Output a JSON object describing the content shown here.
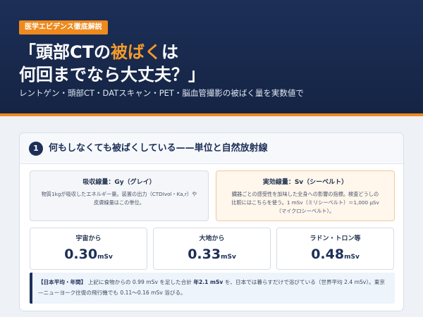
{
  "hero": {
    "badge": "医学エビデンス徹底解説",
    "title_line1_a": "「頭部CTの",
    "title_line1_accent": "被ばく",
    "title_line1_b": "は",
    "title_line2": "何回までなら大丈夫？」",
    "subtitle": "レントゲン・頭部CT・DATスキャン・PET・脳血管撮影の被ばく量を実数値で"
  },
  "section": {
    "number": "1",
    "title": "何もしなくても被ばくしている——単位と自然放射線"
  },
  "definitions": [
    {
      "title": "吸収線量：Gy（グレイ）",
      "body_line1": "物質1kgが吸収したエネルギー量。装置の出力（CTDIvol・Ka,r）や",
      "body_line2": "皮膚線量はこの単位。"
    },
    {
      "title": "実効線量：Sv（シーベルト）",
      "body_line1": "臓器ごとの感受性を加味した全身への影響の指標。検査どうしの",
      "body_line2": "比較にはこちらを使う。1 mSv（ミリシーベルト）＝1,000 μSv",
      "body_line3": "（マイクロシーベルト）。"
    }
  ],
  "stats": [
    {
      "label": "宇宙から",
      "value": "0.30",
      "unit": "mSv"
    },
    {
      "label": "大地から",
      "value": "0.33",
      "unit": "mSv"
    },
    {
      "label": "ラドン・トロン等",
      "value": "0.48",
      "unit": "mSv"
    }
  ],
  "note": {
    "lead": "【日本平均・年間】",
    "text1": "上記に食物からの 0.99 mSv を足した合計",
    "highlight": "年2.1 mSv",
    "text2": "を、日本では暮らすだけで浴びている（世界平均 2.4",
    "text3": "mSv）。東京—ニューヨーク往復の飛行機でも 0.11〜0.16 mSv 浴びる。"
  },
  "colors": {
    "navy": "#1c2f57",
    "accent": "#ee8a1e"
  }
}
